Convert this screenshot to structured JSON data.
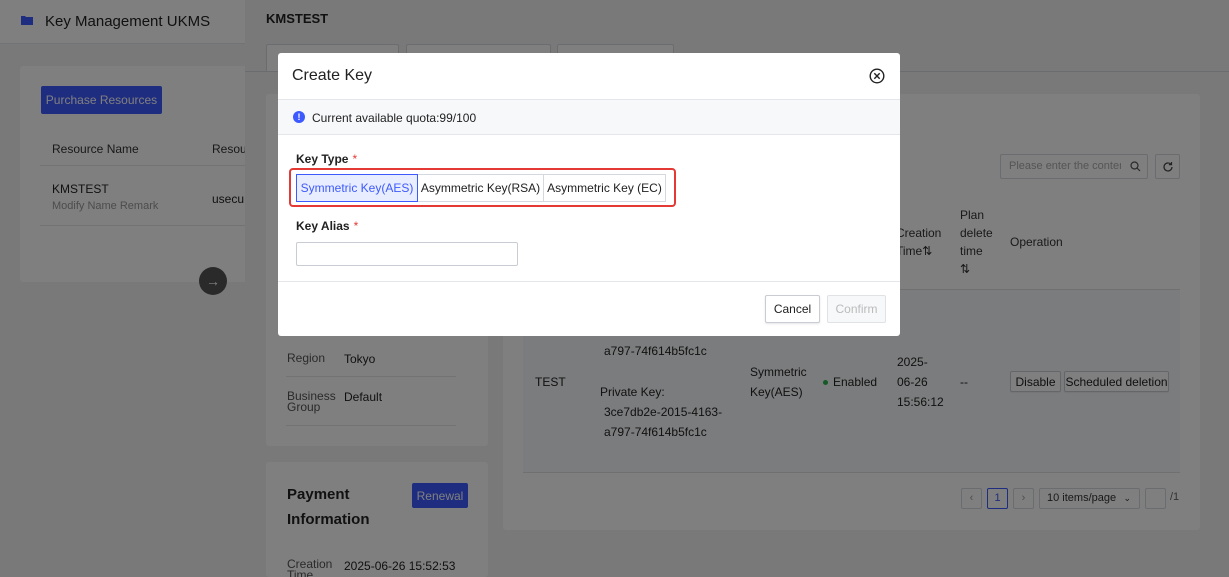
{
  "app": {
    "title": "Key Management UKMS"
  },
  "resource_list": {
    "purchase_label": "Purchase Resources",
    "columns": [
      "Resource Name",
      "Resou"
    ],
    "row": {
      "name": "KMSTEST",
      "subtitle": "Modify Name Remark",
      "id": "usecu"
    }
  },
  "drawer": {
    "title": "KMSTEST",
    "info": {
      "region_label": "Region",
      "region_value": "Tokyo",
      "group_label": "Business Group",
      "group_value": "Default"
    },
    "payment": {
      "heading": "Payment Information",
      "renewal_label": "Renewal",
      "creation_label": "Creation Time",
      "creation_value": "2025-06-26 15:52:53"
    },
    "keys_table": {
      "search_placeholder": "Please enter the content",
      "headers": {
        "creation_time": "Creation Time⇅",
        "plan_delete": "Plan delete time ⇅",
        "operation": "Operation"
      },
      "row": {
        "alias": "TEST",
        "key_fragment_top": "a797-74f614b5fc1c",
        "private_key_label": "Private Key:",
        "private_key_line1": "3ce7db2e-2015-4163-",
        "private_key_line2": "a797-74f614b5fc1c",
        "key_type": "Symmetric Key(AES)",
        "status": "Enabled",
        "creation_time": "2025-06-26 15:56:12",
        "plan_delete": "--",
        "disable_label": "Disable",
        "schedule_label": "Scheduled deletion"
      }
    },
    "pagination": {
      "prev": "‹",
      "current": "1",
      "next": "›",
      "page_size": "10 items/page",
      "total": "/1"
    }
  },
  "modal": {
    "title": "Create Key",
    "quota_text": "Current available quota:99/100",
    "key_type_label": "Key Type",
    "required_mark": "*",
    "key_types": [
      "Symmetric Key(AES)",
      "Asymmetric Key(RSA)",
      "Asymmetric Key (EC)"
    ],
    "selected_key_type": "Symmetric Key(AES)",
    "key_alias_label": "Key Alias",
    "key_alias_value": "",
    "cancel_label": "Cancel",
    "confirm_label": "Confirm"
  },
  "colors": {
    "accent": "#3d5afe",
    "highlight": "#e53935",
    "status_ok": "#2bb24c"
  }
}
